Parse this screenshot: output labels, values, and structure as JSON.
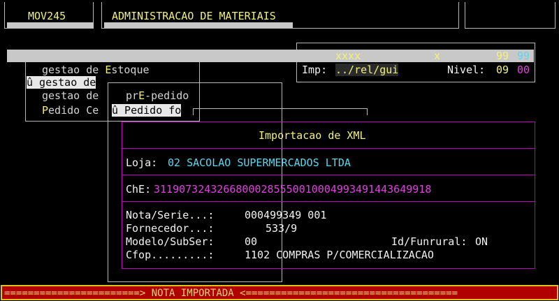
{
  "header": {
    "program_code": "MOV245",
    "system_title": "ADMINISTRACAO DE MATERIAIS"
  },
  "status_bar": {
    "field1": "xxxx",
    "field2": "x",
    "code_left": "99",
    "code_right": "99",
    "imp_label": "Imp:",
    "imp_value": "../rel/gui",
    "nivel_label": "Nivel:",
    "nivel_left": "09",
    "nivel_right": "00"
  },
  "menu": {
    "items": [
      {
        "label": "gestao de Estoque"
      },
      {
        "label": "û gestao de"
      },
      {
        "label": "gestao de"
      },
      {
        "label": "Pedido Ce"
      }
    ],
    "sub_items": [
      {
        "label": "prE-pedido"
      },
      {
        "label": "û Pedido fo"
      }
    ]
  },
  "dialog": {
    "title": "Importacao de XML",
    "loja_label": "Loja:",
    "loja_value": "02 SACOLAO SUPERMERCADOS LTDA",
    "che_label": "ChE:",
    "che_value": "31190732432668000285550010004993491443649918",
    "nota_label": "Nota/Serie...:",
    "nota_value": "000499349 001",
    "fornecedor_label": "Fornecedor...:",
    "fornecedor_value": "533/9",
    "modelo_label": "Modelo/SubSer:",
    "modelo_value": "00",
    "funrural_label": "Id/Funrural:",
    "funrural_value": "ON",
    "cfop_label": "Cfop.........:",
    "cfop_value": "1102 COMPRAS P/COMERCIALIZACAO"
  },
  "footer": {
    "message": "=======================> NOTA IMPORTADA <===================================="
  }
}
